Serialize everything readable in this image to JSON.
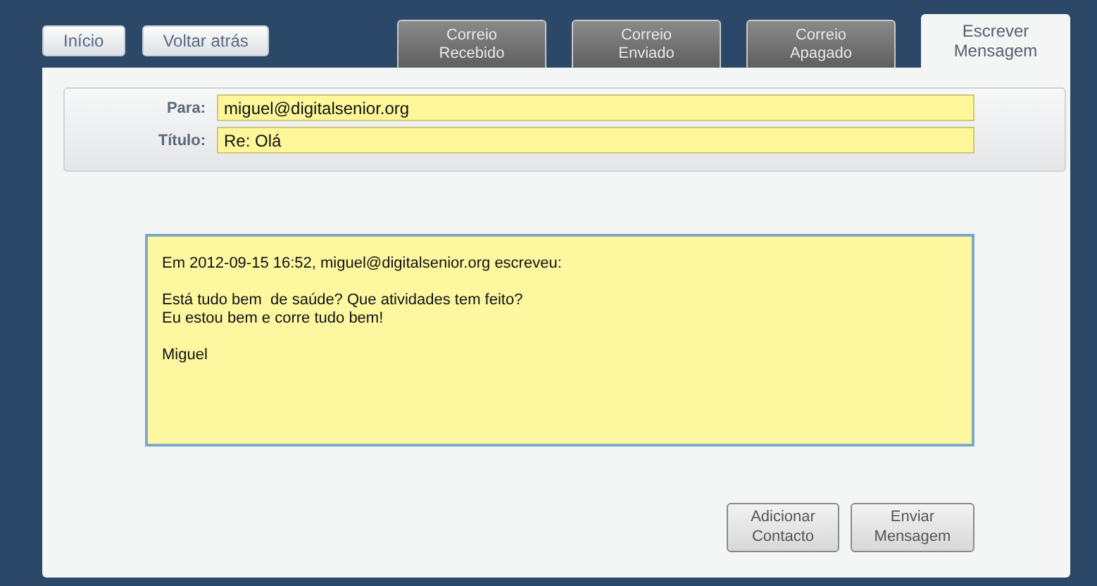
{
  "nav_buttons": [
    "Início",
    "Voltar atrás"
  ],
  "tabs": [
    {
      "label": "Correio\nRecebido",
      "selected": false
    },
    {
      "label": "Correio\nEnviado",
      "selected": false
    },
    {
      "label": "Correio\nApagado",
      "selected": false
    },
    {
      "label": "Escrever\nMensagem",
      "selected": true
    }
  ],
  "fields": [
    {
      "label": "Para:",
      "value": "miguel@digitalsenior.org"
    },
    {
      "label": "Título:",
      "value": "Re: Olá"
    }
  ],
  "message": "Em 2012-09-15 16:52, miguel@digitalsenior.org escreveu:\n\nEstá tudo bem  de saúde? Que atividades tem feito?\nEu estou bem e corre tudo bem!\n\nMiguel",
  "actions": [
    "Adicionar\nContacto",
    "Enviar\nMensagem"
  ]
}
